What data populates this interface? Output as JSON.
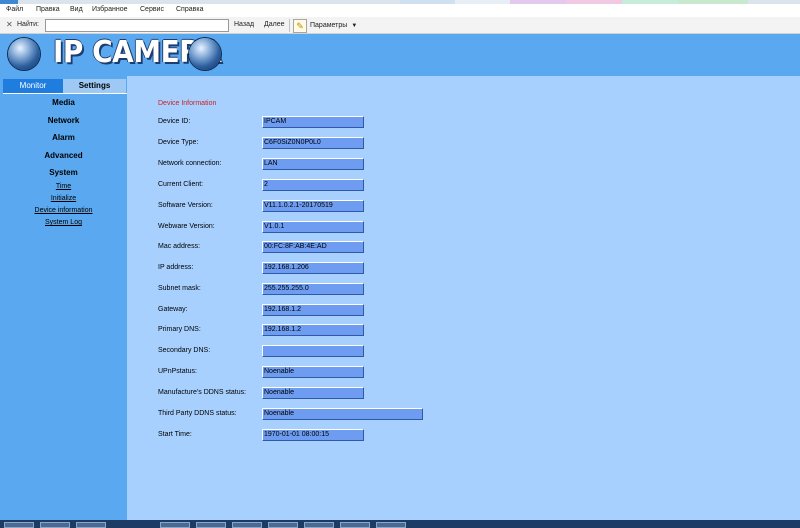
{
  "browser": {
    "menu": [
      "Файл",
      "Правка",
      "Вид",
      "Избранное",
      "Сервис",
      "Справка"
    ],
    "find": {
      "label": "Найти:",
      "value": "",
      "back_label": "Назад",
      "forward_label": "Далее",
      "params_label": "Параметры"
    }
  },
  "app": {
    "logo_text": "IP CAMERA",
    "tabs": [
      {
        "label": "Monitor",
        "active": false
      },
      {
        "label": "Settings",
        "active": true
      }
    ],
    "menu": {
      "media": "Media",
      "network": "Network",
      "alarm": "Alarm",
      "advanced": "Advanced",
      "system": "System",
      "system_items": [
        "Time",
        "Initialize",
        "Device information",
        "System Log"
      ]
    },
    "colors": {
      "banner": "#5aa8ef",
      "content_bg": "#a7d0ff",
      "field_bg": "#6d9cf0",
      "section_title": "#cc2222"
    }
  },
  "device_info": {
    "title": "Device Information",
    "fields": [
      {
        "label": "Device ID:",
        "value": "IPCAM"
      },
      {
        "label": "Device Type:",
        "value": "C6F0SiZ0N0P0L0"
      },
      {
        "label": "Network connection:",
        "value": "LAN"
      },
      {
        "label": "Current Client:",
        "value": "2"
      },
      {
        "label": "Software Version:",
        "value": "V11.1.0.2.1-20170519"
      },
      {
        "label": "Webware Version:",
        "value": "V1.0.1"
      },
      {
        "label": "Mac address:",
        "value": "00:FC:8F:AB:4E:AD"
      },
      {
        "label": "IP address:",
        "value": "192.168.1.206"
      },
      {
        "label": "Subnet mask:",
        "value": "255.255.255.0"
      },
      {
        "label": "Gateway:",
        "value": "192.168.1.2"
      },
      {
        "label": "Primary DNS:",
        "value": "192.168.1.2"
      },
      {
        "label": "Secondary DNS:",
        "value": ""
      },
      {
        "label": "UPnPstatus:",
        "value": "Noenable"
      },
      {
        "label": "Manufacture's DDNS status:",
        "value": "Noenable"
      },
      {
        "label": "Third Party DDNS status:",
        "value": "Noenable"
      },
      {
        "label": "Start Time:",
        "value": "1970-01-01 08:00:15"
      }
    ]
  }
}
